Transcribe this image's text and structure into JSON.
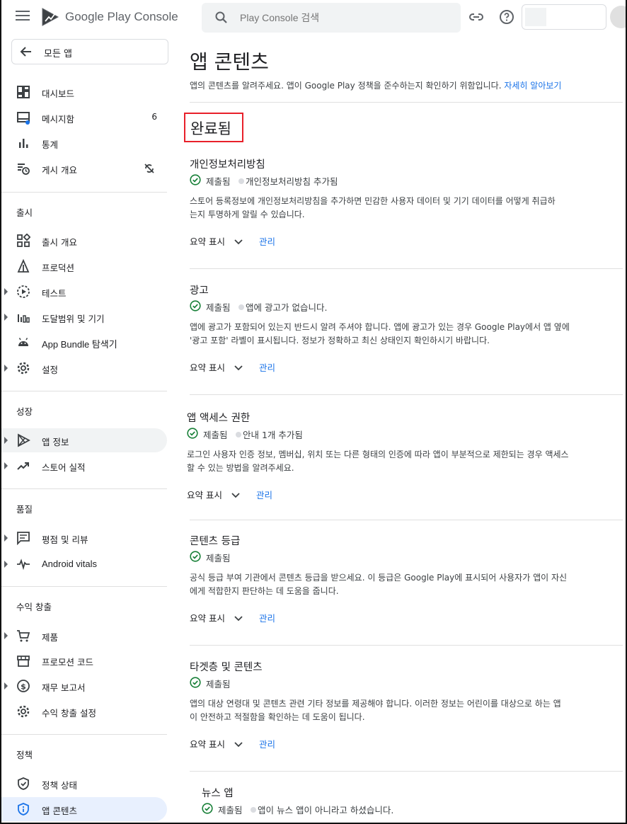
{
  "header": {
    "brand": "Google Play Console",
    "search_placeholder": "Play Console 검색"
  },
  "sidebar": {
    "back_label": "모든 앱",
    "top_items": [
      {
        "label": "대시보드"
      },
      {
        "label": "메시지함",
        "badge": "6"
      },
      {
        "label": "통계"
      },
      {
        "label": "게시 개요"
      }
    ],
    "sections": {
      "release": "출시",
      "growth": "성장",
      "quality": "품질",
      "monetize": "수익 창출",
      "policy": "정책"
    },
    "release_items": [
      {
        "label": "출시 개요"
      },
      {
        "label": "프로덕션"
      },
      {
        "label": "테스트"
      },
      {
        "label": "도달범위 및 기기"
      },
      {
        "label": "App Bundle 탐색기"
      },
      {
        "label": "설정"
      }
    ],
    "growth_items": [
      {
        "label": "앱 정보"
      },
      {
        "label": "스토어 실적"
      }
    ],
    "quality_items": [
      {
        "label": "평점 및 리뷰"
      },
      {
        "label": "Android vitals"
      }
    ],
    "monetize_items": [
      {
        "label": "제품"
      },
      {
        "label": "프로모션 코드"
      },
      {
        "label": "재무 보고서"
      },
      {
        "label": "수익 창출 설정"
      }
    ],
    "policy_items": [
      {
        "label": "정책 상태"
      },
      {
        "label": "앱 콘텐츠"
      }
    ]
  },
  "main": {
    "title": "앱 콘텐츠",
    "description": "앱의 콘텐츠를 알려주세요. 앱이 Google Play 정책을 준수하는지 확인하기 위함입니다.",
    "learn_more": "자세히 알아보기",
    "completed_heading": "완료됨",
    "summary_label": "요약 표시",
    "manage_label": "관리",
    "cards": [
      {
        "title": "개인정보처리방침",
        "status": "제출됨",
        "note": "개인정보처리방침 추가됨",
        "desc_line1": "스토어 등록정보에 개인정보처리방침을 추가하면 민감한 사용자 데이터 및 기기 데이터를 어떻게 취급하",
        "desc_line2": "는지 투명하게 알릴 수 있습니다."
      },
      {
        "title": "광고",
        "status": "제출됨",
        "note": "앱에 광고가 없습니다.",
        "desc_line1": "앱에 광고가 포함되어 있는지 반드시 알려 주셔야 합니다. 앱에 광고가 있는 경우 Google Play에서 앱 옆에",
        "desc_line2": "'광고 포함' 라벨이 표시됩니다. 정보가 정확하고 최신 상태인지 확인하시기 바랍니다."
      },
      {
        "title": "앱 액세스 권한",
        "status": "제출됨",
        "note": "안내 1개 추가됨",
        "desc_line1": "로그인 사용자 인증 정보, 멤버십, 위치 또는 다른 형태의 인증에 따라 앱이 부분적으로 제한되는 경우 액세스",
        "desc_line2": "할 수 있는 방법을 알려주세요."
      },
      {
        "title": "콘텐츠 등급",
        "status": "제출됨",
        "note": "",
        "desc_line1": "공식 등급 부여 기관에서 콘텐츠 등급을 받으세요. 이 등급은 Google Play에 표시되어 사용자가 앱이 자신",
        "desc_line2": "에게 적합한지 판단하는 데 도움을 줍니다."
      },
      {
        "title": "타겟층 및 콘텐츠",
        "status": "제출됨",
        "note": "",
        "desc_line1": "앱의 대상 연령대 및 콘텐츠 관련 기타 정보를 제공해야 합니다. 이러한 정보는 어린이를 대상으로 하는 앱",
        "desc_line2": "이 안전하고 적절함을 확인하는 데 도움이 됩니다."
      },
      {
        "title": "뉴스 앱",
        "status": "제출됨",
        "note": "앱이 뉴스 앱이 아니라고 하셨습니다."
      }
    ]
  },
  "colors": {
    "accent": "#1a73e8",
    "success": "#188038",
    "highlight_border": "#e8202a",
    "active_nav": "#e8f0fe"
  }
}
